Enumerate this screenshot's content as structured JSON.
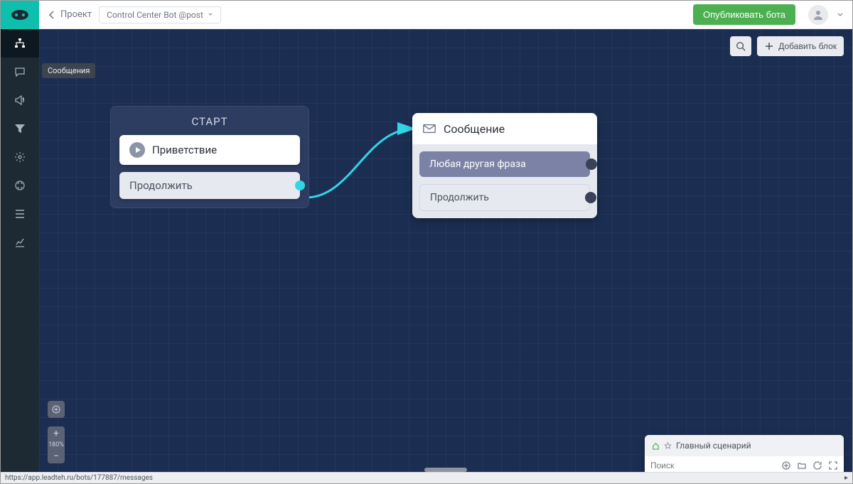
{
  "header": {
    "back_label": "Проект",
    "bot_name": "Control Center Bot @post",
    "publish_label": "Опубликовать бота"
  },
  "canvas": {
    "tooltip": "Сообщения",
    "search_btn": "",
    "add_block": "Добавить блок",
    "zoom": "180%"
  },
  "nodes": {
    "start": {
      "title": "СТАРТ",
      "step1": "Приветствие",
      "step2": "Продолжить"
    },
    "message": {
      "title": "Сообщение",
      "row1": "Любая другая фраза",
      "row2": "Продолжить"
    }
  },
  "scenario": {
    "title": "Главный сценарий",
    "search_placeholder": "Поиск"
  },
  "status": {
    "url": "https://app.leadteh.ru/bots/177887/messages"
  }
}
